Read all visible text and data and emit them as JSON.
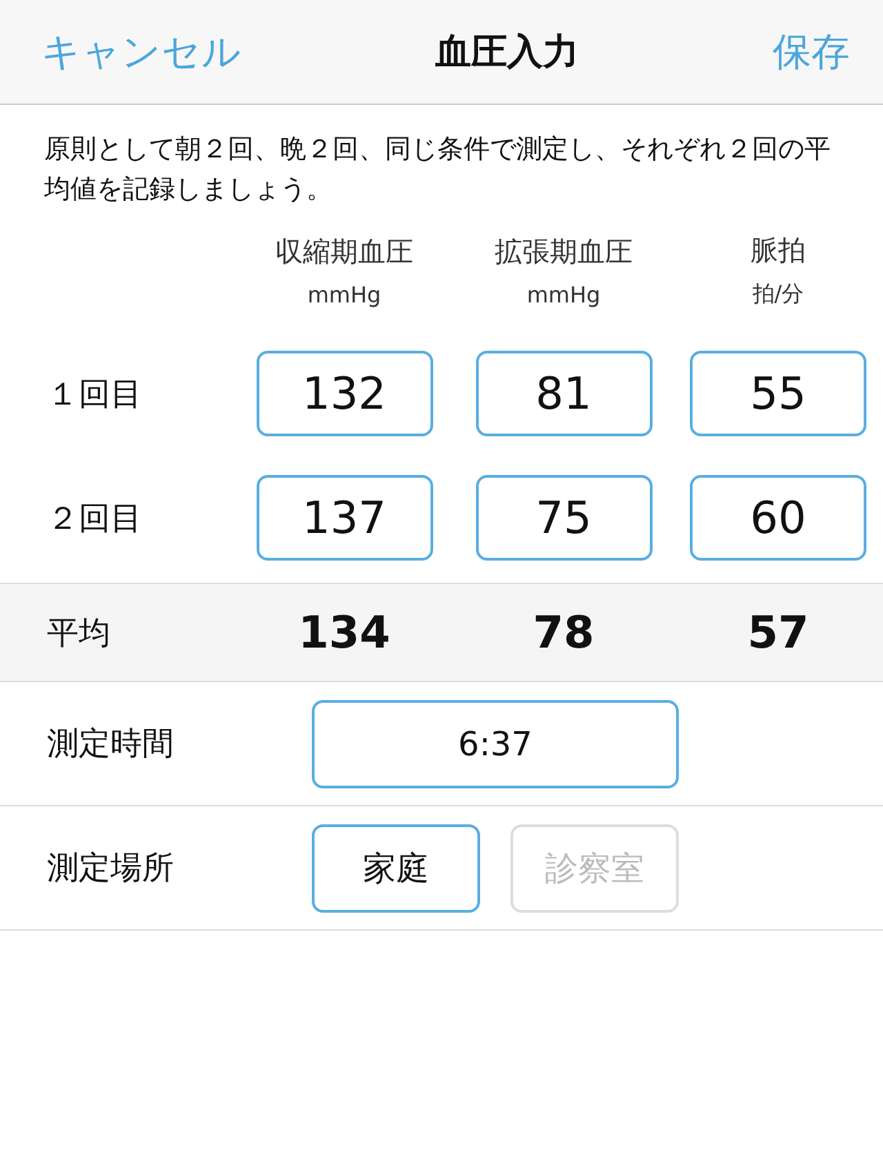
{
  "nav": {
    "cancel": "キャンセル",
    "title": "血圧入力",
    "save": "保存"
  },
  "instruction": "原則として朝２回、晩２回、同じ条件で測定し、それぞれ２回の平均値を記録しましょう。",
  "columns": [
    {
      "name": "収縮期血圧",
      "unit": "mmHg"
    },
    {
      "name": "拡張期血圧",
      "unit": "mmHg"
    },
    {
      "name": "脈拍",
      "unit": "拍/分"
    }
  ],
  "readings": [
    {
      "label": "１回目",
      "values": [
        "132",
        "81",
        "55"
      ]
    },
    {
      "label": "２回目",
      "values": [
        "137",
        "75",
        "60"
      ]
    }
  ],
  "average": {
    "label": "平均",
    "values": [
      "134",
      "78",
      "57"
    ]
  },
  "time": {
    "label": "測定時間",
    "value": "6:37"
  },
  "place": {
    "label": "測定場所",
    "options": [
      {
        "label": "家庭",
        "selected": true
      },
      {
        "label": "診察室",
        "selected": false
      }
    ]
  }
}
